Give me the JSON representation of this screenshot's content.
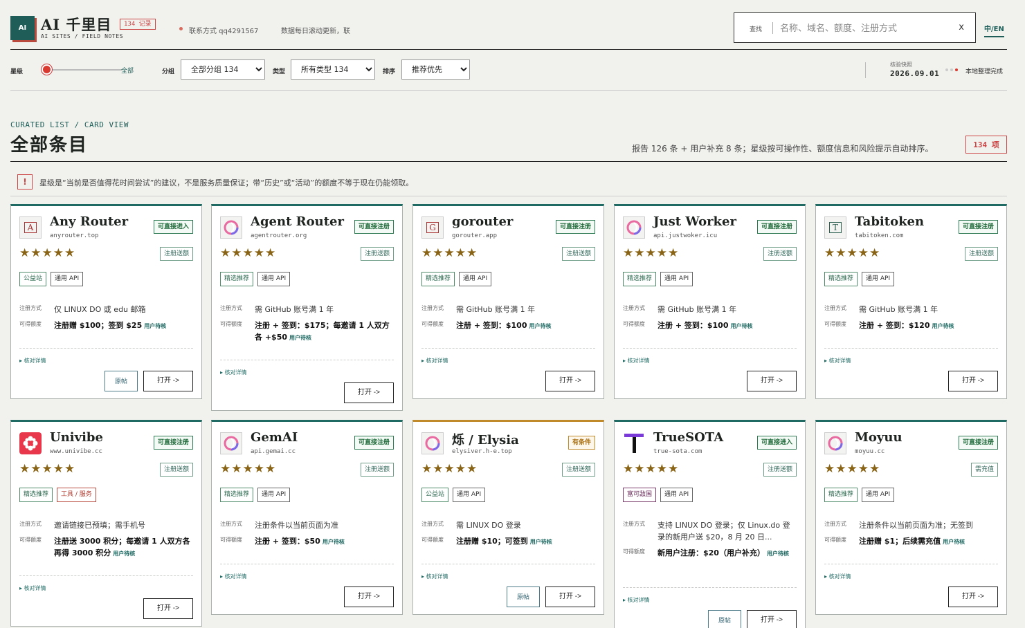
{
  "header": {
    "logo": "AI",
    "title": "AI 千里目",
    "subtitle": "AI SITES / FIELD NOTES",
    "record_badge": "134 记录",
    "contact": "联系方式 qq4291567",
    "ticker": "数据每日滚动更新，联",
    "search_label": "查找",
    "search_placeholder": "名称、域名、额度、注册方式",
    "search_clear": "x",
    "lang": "中/EN"
  },
  "filters": {
    "star_label": "星级",
    "star_value": "全部",
    "star_fraction": 0,
    "group_label": "分组",
    "group_value": "全部分组 134",
    "type_label": "类型",
    "type_value": "所有类型 134",
    "sort_label": "排序",
    "sort_value": "推荐优先",
    "date_label": "核验快照",
    "date_value": "2026.09.01",
    "status": "本地整理完成"
  },
  "section": {
    "kicker": "CURATED LIST / CARD VIEW",
    "title": "全部条目",
    "meta": "报告 126 条 + 用户补充 8 条；星级按可操作性、额度信息和风险提示自动排序。",
    "count": "134 项"
  },
  "notice": {
    "icon": "!",
    "text": "星级是“当前是否值得花时间尝试”的建议，不是服务质量保证；带“历史”或“活动”的额度不等于现在仍能领取。"
  },
  "labels": {
    "reg": "注册方式",
    "quota": "可得额度",
    "user": "用户待核",
    "details": "▸ 核对详情",
    "original": "原帖",
    "open": "打开 ->"
  },
  "cards": [
    {
      "name": "Any Router",
      "domain": "anyrouter.top",
      "logo": "A",
      "logo_type": "letter",
      "status": "可直接进入",
      "status_kind": "ok",
      "stars": "★★★★★",
      "rating": 5,
      "bonus": "注册送额",
      "tags": [
        "公益站",
        "通用 API"
      ],
      "tag_kinds": [
        "green",
        "gray"
      ],
      "reg": "仅 LINUX DO 或 edu 邮箱",
      "quota": "注册赠 $100；签到 $25",
      "has_original": true
    },
    {
      "name": "Agent Router",
      "domain": "agentrouter.org",
      "logo": "",
      "logo_type": "flower",
      "status": "可直接注册",
      "status_kind": "ok",
      "stars": "★★★★★",
      "rating": 5,
      "bonus": "注册送额",
      "tags": [
        "精选推荐",
        "通用 API"
      ],
      "tag_kinds": [
        "green",
        "gray"
      ],
      "reg": "需 GitHub 账号满 1 年",
      "quota": "注册 + 签到：$175；每邀请 1 人双方各 +$50",
      "has_original": false
    },
    {
      "name": "gorouter",
      "domain": "gorouter.app",
      "logo": "G",
      "logo_type": "letter",
      "status": "可直接注册",
      "status_kind": "ok",
      "stars": "★★★★★",
      "rating": 5,
      "bonus": "注册送额",
      "tags": [
        "精选推荐",
        "通用 API"
      ],
      "tag_kinds": [
        "green",
        "gray"
      ],
      "reg": "需 GitHub 账号满 1 年",
      "quota": "注册 + 签到：$100",
      "has_original": false
    },
    {
      "name": "Just Worker",
      "domain": "api.justwoker.icu",
      "logo": "",
      "logo_type": "flower",
      "status": "可直接注册",
      "status_kind": "ok",
      "stars": "★★★★★",
      "rating": 5,
      "bonus": "注册送额",
      "tags": [
        "精选推荐",
        "通用 API"
      ],
      "tag_kinds": [
        "green",
        "gray"
      ],
      "reg": "需 GitHub 账号满 1 年",
      "quota": "注册 + 签到：$100",
      "has_original": false
    },
    {
      "name": "Tabitoken",
      "domain": "tabitoken.com",
      "logo": "T",
      "logo_type": "letter-green",
      "status": "可直接注册",
      "status_kind": "ok",
      "stars": "★★★★★",
      "rating": 5,
      "bonus": "注册送额",
      "tags": [
        "精选推荐",
        "通用 API"
      ],
      "tag_kinds": [
        "green",
        "gray"
      ],
      "reg": "需 GitHub 账号满 1 年",
      "quota": "注册 + 签到：$120",
      "has_original": false
    },
    {
      "name": "Univibe",
      "domain": "www.univibe.cc",
      "logo": "",
      "logo_type": "univibe",
      "status": "可直接注册",
      "status_kind": "ok",
      "stars": "★★★★★",
      "rating": 5,
      "bonus": "注册送额",
      "tags": [
        "精选推荐",
        "工具 / 服务"
      ],
      "tag_kinds": [
        "green",
        "red"
      ],
      "reg": "邀请链接已预填；需手机号",
      "quota": "注册送 3000 积分；每邀请 1 人双方各再得 3000 积分",
      "has_original": false
    },
    {
      "name": "GemAI",
      "domain": "api.gemai.cc",
      "logo": "",
      "logo_type": "flower",
      "status": "可直接注册",
      "status_kind": "ok",
      "stars": "★★★★★",
      "rating": 5,
      "bonus": "注册送额",
      "tags": [
        "精选推荐",
        "通用 API"
      ],
      "tag_kinds": [
        "green",
        "gray"
      ],
      "reg": "注册条件以当前页面为准",
      "quota": "注册 + 签到：$50",
      "has_original": false
    },
    {
      "name": "烁 / Elysia",
      "domain": "elysiver.h-e.top",
      "logo": "",
      "logo_type": "flower",
      "status": "有条件",
      "status_kind": "cond",
      "stars": "★★★★★",
      "rating": 5,
      "bonus": "注册送额",
      "tags": [
        "公益站",
        "通用 API"
      ],
      "tag_kinds": [
        "green",
        "gray"
      ],
      "reg": "需 LINUX DO 登录",
      "quota": "注册赠 $10；可签到",
      "has_original": true
    },
    {
      "name": "TrueSOTA",
      "domain": "true-sota.com",
      "logo": "",
      "logo_type": "truesota",
      "status": "可直接进入",
      "status_kind": "ok",
      "stars": "★★★★★",
      "rating": 5,
      "bonus": "注册送额",
      "tags": [
        "富可敌国",
        "通用 API"
      ],
      "tag_kinds": [
        "purple",
        "gray"
      ],
      "reg": "支持 LINUX DO 登录；仅 Linux.do 登录的新用户送 $20，8 月 20 日...",
      "quota": "新用户注册：$20（用户补充）",
      "has_original": true
    },
    {
      "name": "Moyuu",
      "domain": "moyuu.cc",
      "logo": "",
      "logo_type": "flower",
      "status": "可直接注册",
      "status_kind": "ok",
      "stars": "★★★★★",
      "rating": 5,
      "bonus": "需充值",
      "tags": [
        "精选推荐",
        "通用 API"
      ],
      "tag_kinds": [
        "green",
        "gray"
      ],
      "reg": "注册条件以当前页面为准；无签到",
      "quota": "注册赠 $1；后续需充值",
      "has_original": false
    }
  ]
}
